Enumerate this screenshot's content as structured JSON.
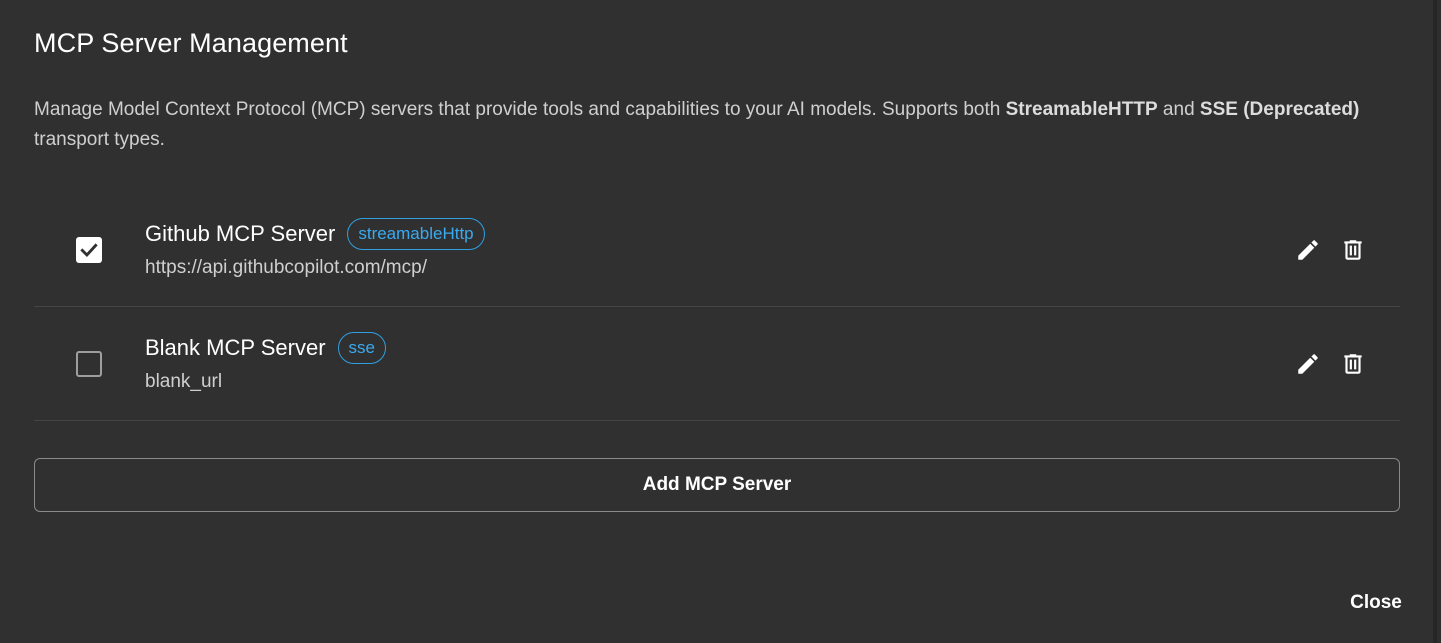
{
  "dialog": {
    "title": "MCP Server Management",
    "description_parts": {
      "before": "Manage Model Context Protocol (MCP) servers that provide tools and capabilities to your AI models. Supports both ",
      "bold1": "StreamableHTTP",
      "middle": " and ",
      "bold2": "SSE (Deprecated)",
      "after": " transport types."
    }
  },
  "servers": [
    {
      "name": "Github MCP Server",
      "transport": "streamableHttp",
      "url": "https://api.githubcopilot.com/mcp/",
      "enabled": true
    },
    {
      "name": "Blank MCP Server",
      "transport": "sse",
      "url": "blank_url",
      "enabled": false
    }
  ],
  "icons": {
    "edit": "pencil-icon",
    "delete": "trash-icon",
    "checked": "check-icon"
  },
  "colors": {
    "background": "#303030",
    "badge": "#3aaaf0",
    "divider": "#454545"
  },
  "actions": {
    "add_label": "Add MCP Server",
    "close_label": "Close"
  }
}
